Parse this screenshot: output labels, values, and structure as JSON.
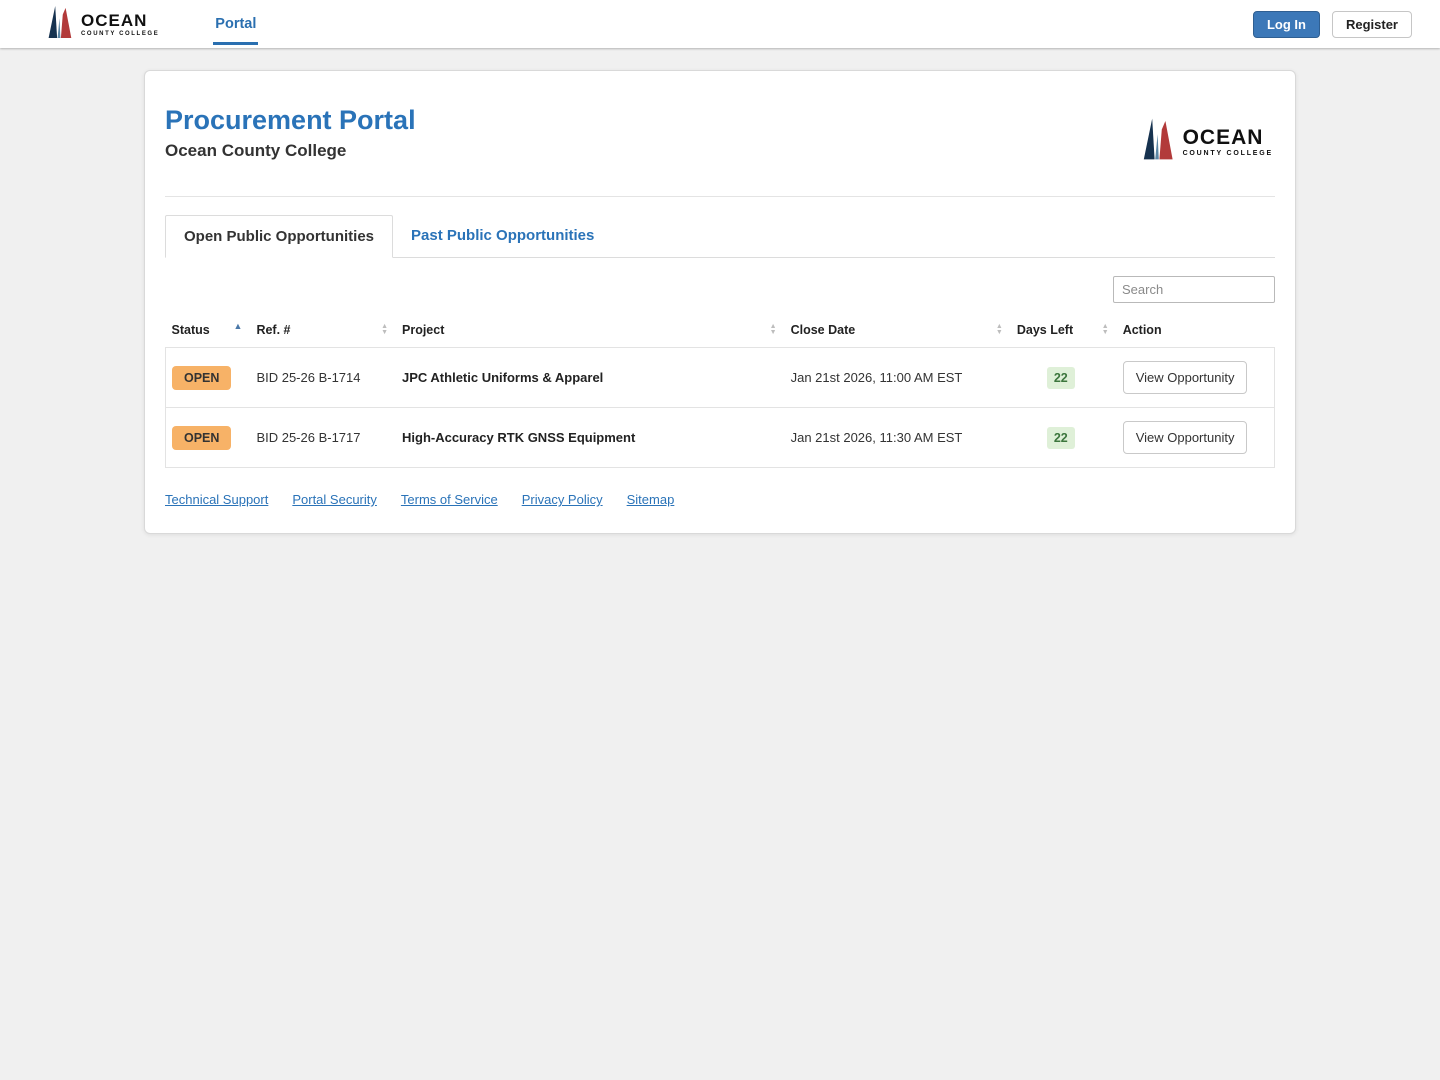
{
  "colors": {
    "primary_blue": "#2a73b8",
    "login_button_bg": "#3c78b8",
    "open_badge_bg": "#f7b267",
    "days_left_bg": "#dff0d8",
    "days_left_text": "#3c763d",
    "page_bg": "#f0f0f0"
  },
  "brand": {
    "name": "OCEAN",
    "sub": "COUNTY COLLEGE"
  },
  "navbar": {
    "portal_link": "Portal",
    "login_label": "Log In",
    "register_label": "Register"
  },
  "card": {
    "title": "Procurement Portal",
    "subtitle": "Ocean County College",
    "tabs": [
      {
        "label": "Open Public Opportunities",
        "active": true
      },
      {
        "label": "Past Public Opportunities",
        "active": false
      }
    ],
    "search": {
      "placeholder": "Search"
    },
    "table": {
      "headers": [
        "Status",
        "Ref. #",
        "Project",
        "Close Date",
        "Days Left",
        "Action"
      ],
      "rows": [
        {
          "status": "OPEN",
          "ref": "BID 25-26 B-1714",
          "project": "JPC Athletic Uniforms & Apparel",
          "close_date": "Jan 21st 2026, 11:00 AM EST",
          "days_left": "22",
          "action": "View Opportunity"
        },
        {
          "status": "OPEN",
          "ref": "BID 25-26 B-1717",
          "project": "High-Accuracy RTK GNSS Equipment",
          "close_date": "Jan 21st 2026, 11:30 AM EST",
          "days_left": "22",
          "action": "View Opportunity"
        }
      ]
    },
    "footer_links": [
      "Technical Support",
      "Portal Security",
      "Terms of Service",
      "Privacy Policy",
      "Sitemap"
    ]
  },
  "icons": {
    "sort_asc": "▲",
    "sort_up": "▲",
    "sort_down": "▼"
  }
}
